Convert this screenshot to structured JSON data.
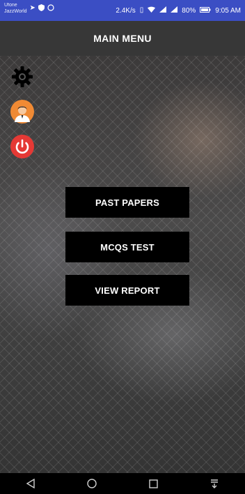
{
  "status_bar": {
    "carrier_top": "Ufone",
    "carrier_bottom": "JazzWorld",
    "speed": "2.4K/s",
    "battery": "80%",
    "time": "9:05 AM"
  },
  "app_bar": {
    "title": "MAIN MENU"
  },
  "sidebar": {
    "icons": [
      "gear-icon",
      "avatar",
      "power-icon"
    ]
  },
  "menu": {
    "past_papers": "PAST PAPERS",
    "mcqs_test": "MCQS TEST",
    "view_report": "VIEW REPORT"
  },
  "nav": {
    "icons": [
      "back-icon",
      "home-icon",
      "recents-icon",
      "notification-icon"
    ]
  },
  "colors": {
    "status_bar": "#3b4ec4",
    "app_bar": "#373737",
    "button": "#000000",
    "power": "#e53935",
    "avatar": "#f08a34"
  }
}
